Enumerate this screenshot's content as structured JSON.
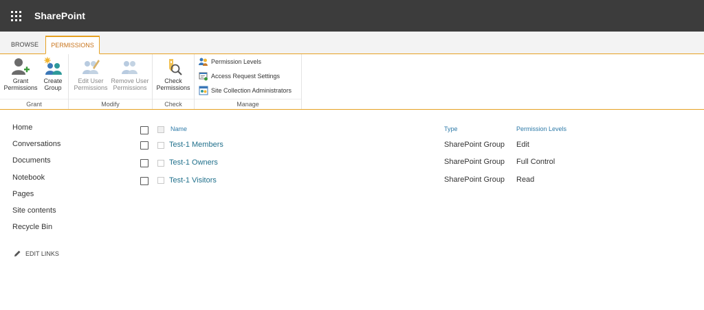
{
  "suite": {
    "brand": "SharePoint"
  },
  "tabs": {
    "browse": "BROWSE",
    "permissions": "PERMISSIONS"
  },
  "ribbon": {
    "grant": {
      "label": "Grant",
      "grant_permissions": "Grant\nPermissions",
      "create_group": "Create\nGroup"
    },
    "modify": {
      "label": "Modify",
      "edit_user_permissions": "Edit User\nPermissions",
      "remove_user_permissions": "Remove User\nPermissions"
    },
    "check": {
      "label": "Check",
      "check_permissions": "Check\nPermissions"
    },
    "manage": {
      "label": "Manage",
      "permission_levels": "Permission Levels",
      "access_request_settings": "Access Request Settings",
      "site_collection_admins": "Site Collection Administrators"
    }
  },
  "nav": {
    "items": [
      "Home",
      "Conversations",
      "Documents",
      "Notebook",
      "Pages",
      "Site contents",
      "Recycle Bin"
    ],
    "edit_links": "EDIT LINKS"
  },
  "table": {
    "headers": {
      "name": "Name",
      "type": "Type",
      "permission_levels": "Permission Levels"
    },
    "rows": [
      {
        "name": "Test-1 Members",
        "type": "SharePoint Group",
        "level": "Edit"
      },
      {
        "name": "Test-1 Owners",
        "type": "SharePoint Group",
        "level": "Full Control"
      },
      {
        "name": "Test-1 Visitors",
        "type": "SharePoint Group",
        "level": "Read"
      }
    ]
  }
}
